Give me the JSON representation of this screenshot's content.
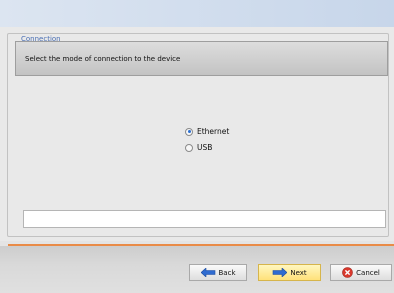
{
  "group": {
    "legend": "Connection"
  },
  "header": {
    "instruction": "Select the mode of connection to the device"
  },
  "connection_options": [
    {
      "label": "Ethernet",
      "selected": true
    },
    {
      "label": "USB",
      "selected": false
    }
  ],
  "status": {
    "text": ""
  },
  "buttons": {
    "back": "Back",
    "next": "Next",
    "cancel": "Cancel"
  },
  "icons": {
    "back": "arrow-left-icon",
    "next": "arrow-right-icon",
    "cancel": "cancel-x-icon"
  },
  "colors": {
    "accent_orange": "#e98b47",
    "legend_blue": "#4a6fb4",
    "next_button": "#ffe17a",
    "cancel_red": "#d9382c",
    "arrow_blue": "#2f6bd0"
  }
}
